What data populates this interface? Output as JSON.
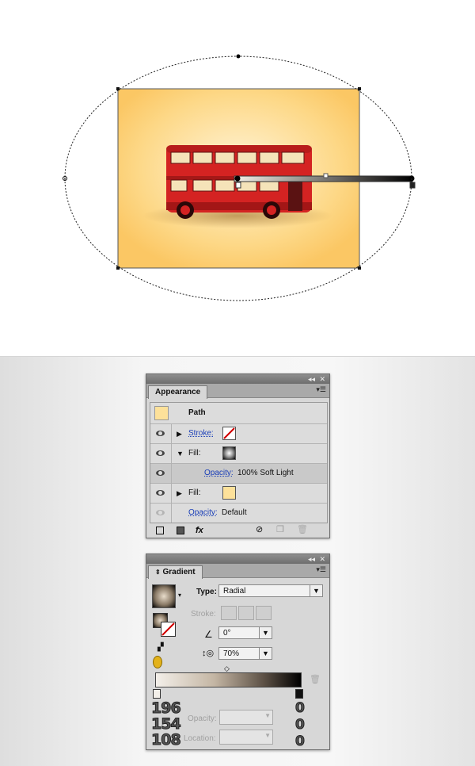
{
  "appearance_panel": {
    "tab_label": "Appearance",
    "collapse_glyph": "◂◂",
    "close_glyph": "✕",
    "menu_glyph": "▾☰",
    "header": {
      "label": "Path",
      "swatch_color": "#fde19a"
    },
    "rows": [
      {
        "label": "Stroke:",
        "value": "",
        "link": true,
        "icon": "none-swatch-icon"
      },
      {
        "label": "Fill:",
        "value": "",
        "link": false,
        "icon": "radial-gradient-swatch-icon"
      },
      {
        "label": "Opacity:",
        "value": "100% Soft Light",
        "link": true
      },
      {
        "label": "Fill:",
        "value": "",
        "link": false,
        "icon": "yellow-swatch-icon",
        "swatch_color": "#fde19a"
      },
      {
        "label": "Opacity:",
        "value": "Default",
        "link": true
      }
    ],
    "footer": {
      "fx_label": "fx",
      "fx_arrow": "▾"
    }
  },
  "gradient_panel": {
    "tab_label": "Gradient",
    "tab_arrows": "⇕",
    "collapse_glyph": "◂◂",
    "close_glyph": "✕",
    "menu_glyph": "▾☰",
    "type_label": "Type:",
    "type_value": "Radial",
    "stroke_label": "Stroke:",
    "angle_value": "0°",
    "aspect_value": "70%",
    "opacity_label": "Opacity:",
    "location_label": "Location:",
    "color_values": [
      "196",
      "154",
      "108"
    ],
    "right_values": [
      "0",
      "0",
      "0"
    ],
    "gradient_colors": {
      "start": "#c49a6c",
      "end": "#000000"
    }
  },
  "artwork": {
    "background_color": "#fcc968",
    "bus_color": "#d42322"
  }
}
